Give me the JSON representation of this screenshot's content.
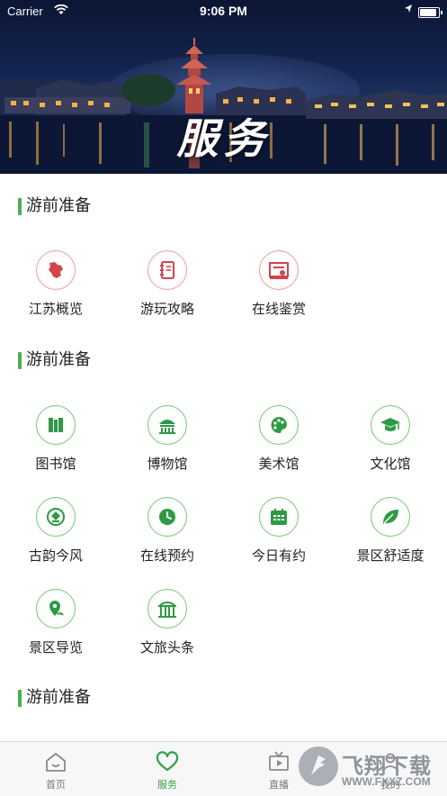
{
  "status_bar": {
    "carrier": "Carrier",
    "time": "9:06 PM",
    "battery_level": 1.0
  },
  "hero": {
    "title": "服务"
  },
  "sections": [
    {
      "title": "游前准备",
      "items": [
        {
          "label": "江苏概览",
          "icon": "jiangsu-map-icon",
          "color": "red"
        },
        {
          "label": "游玩攻略",
          "icon": "notebook-icon",
          "color": "red"
        },
        {
          "label": "在线鉴赏",
          "icon": "artwork-icon",
          "color": "red"
        }
      ]
    },
    {
      "title": "游前准备",
      "items": [
        {
          "label": "图书馆",
          "icon": "books-icon",
          "color": "green"
        },
        {
          "label": "博物馆",
          "icon": "museum-icon",
          "color": "green"
        },
        {
          "label": "美术馆",
          "icon": "palette-icon",
          "color": "green"
        },
        {
          "label": "文化馆",
          "icon": "graduation-cap-icon",
          "color": "green"
        },
        {
          "label": "古韵今风",
          "icon": "ancient-pattern-icon",
          "color": "green"
        },
        {
          "label": "在线预约",
          "icon": "clock-icon",
          "color": "green"
        },
        {
          "label": "今日有约",
          "icon": "calendar-icon",
          "color": "green"
        },
        {
          "label": "景区舒适度",
          "icon": "leaf-icon",
          "color": "green"
        },
        {
          "label": "景区导览",
          "icon": "map-pin-icon",
          "color": "green"
        },
        {
          "label": "文旅头条",
          "icon": "gate-icon",
          "color": "green"
        }
      ]
    },
    {
      "title": "游前准备",
      "items": []
    }
  ],
  "tabbar": [
    {
      "label": "首页",
      "icon": "home-icon",
      "active": false
    },
    {
      "label": "服务",
      "icon": "heart-icon",
      "active": true
    },
    {
      "label": "直播",
      "icon": "tv-icon",
      "active": false
    },
    {
      "label": "我的",
      "icon": "profile-icon",
      "active": false
    }
  ],
  "watermark": {
    "brand": "飞翔下载",
    "url": "WWW.FXXZ.COM"
  },
  "colors": {
    "accent_green": "#33a046",
    "section_bar": "#4cae4f",
    "icon_red": "#d3444c",
    "icon_green": "#2e9a45"
  }
}
